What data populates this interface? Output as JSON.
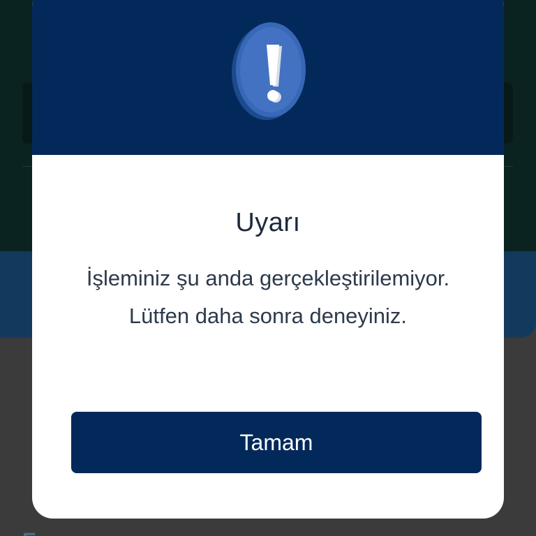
{
  "background": {
    "partial_label": "E"
  },
  "dialog": {
    "icon": "exclamation-alert-icon",
    "title": "Uyarı",
    "message": "İşleminiz şu anda gerçekleştirilemiyor. Lütfen daha sonra deneyiniz.",
    "ok_button_label": "Tamam"
  },
  "colors": {
    "header": "#03295a",
    "button": "#03295a",
    "icon_blue": "#3767b7",
    "text": "#1c2a3c"
  }
}
